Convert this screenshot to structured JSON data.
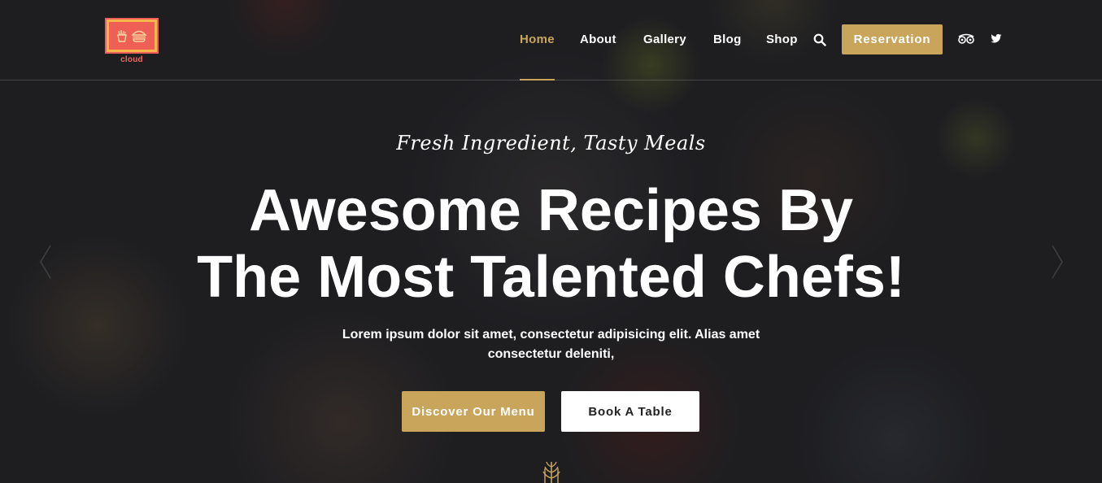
{
  "logo": {
    "text": "cloud",
    "icon": "fries-burger-icon"
  },
  "nav": {
    "items": [
      {
        "label": "Home",
        "active": true
      },
      {
        "label": "About",
        "active": false
      },
      {
        "label": "Gallery",
        "active": false
      },
      {
        "label": "Blog",
        "active": false
      },
      {
        "label": "Shop",
        "active": false
      }
    ],
    "search_icon": "search-icon",
    "reservation_label": "Reservation",
    "social_icons": [
      "tripadvisor-icon",
      "twitter-icon"
    ]
  },
  "hero": {
    "subtitle": "Fresh Ingredient, Tasty Meals",
    "headline_line1": "Awesome Recipes By",
    "headline_line2": "The Most Talented Chefs!",
    "description": "Lorem ipsum dolor sit amet, consectetur adipisicing elit. Alias amet consectetur deleniti,",
    "primary_button": "Discover Our Menu",
    "secondary_button": "Book A Table",
    "prev_icon": "chevron-left-icon",
    "next_icon": "chevron-right-icon",
    "scroll_icon": "wheat-icon"
  },
  "colors": {
    "accent": "#c9a55c",
    "background": "#232326",
    "logo_red": "#ee5f55",
    "logo_yellow": "#f8b64a"
  }
}
